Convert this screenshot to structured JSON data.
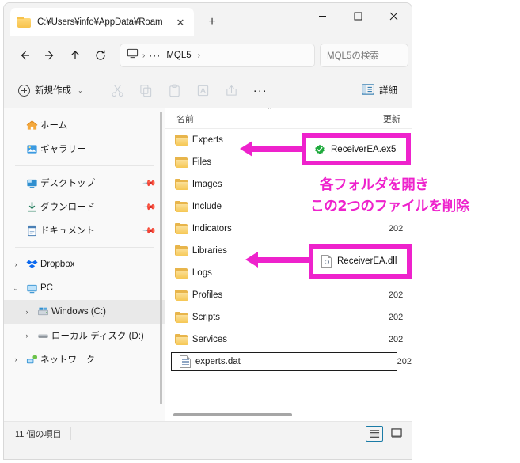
{
  "window": {
    "tab_title": "C:¥Users¥info¥AppData¥Roam",
    "tab_close_label": "✕",
    "new_tab_label": "+",
    "minimize_label": "Minimize",
    "maximize_label": "Maximize",
    "close_label": "Close"
  },
  "nav": {
    "back_label": "←",
    "forward_label": "→",
    "up_label": "↑",
    "refresh_label": "⟳",
    "breadcrumb": [
      {
        "type": "icon",
        "label": "this-pc"
      },
      {
        "type": "sep",
        "label": "›"
      },
      {
        "type": "ellipsis",
        "label": "···"
      },
      {
        "type": "crumb",
        "label": "MQL5"
      },
      {
        "type": "sep",
        "label": "›"
      }
    ],
    "search_placeholder": "MQL5の検索"
  },
  "toolbar": {
    "new_label": "新規作成",
    "new_chevron": "⌄",
    "cut_label": "Cut",
    "copy_label": "Copy",
    "paste_label": "Paste",
    "rename_label": "Rename",
    "share_label": "Share",
    "more_label": "···",
    "details_label": "詳細"
  },
  "sidebar": {
    "groups": [
      {
        "items": [
          {
            "label": "ホーム",
            "icon": "home-icon",
            "caret": "",
            "pin": false,
            "selected": false,
            "indent": 0
          },
          {
            "label": "ギャラリー",
            "icon": "gallery-icon",
            "caret": "",
            "pin": false,
            "selected": false,
            "indent": 0
          }
        ]
      },
      {
        "items": [
          {
            "label": "デスクトップ",
            "icon": "desktop-icon",
            "caret": "",
            "pin": true,
            "selected": false,
            "indent": 0
          },
          {
            "label": "ダウンロード",
            "icon": "download-icon",
            "caret": "",
            "pin": true,
            "selected": false,
            "indent": 0
          },
          {
            "label": "ドキュメント",
            "icon": "document-icon",
            "caret": "",
            "pin": true,
            "selected": false,
            "indent": 0
          }
        ]
      },
      {
        "items": [
          {
            "label": "Dropbox",
            "icon": "dropbox-icon",
            "caret": "›",
            "pin": false,
            "selected": false,
            "indent": 0
          },
          {
            "label": "PC",
            "icon": "pc-icon",
            "caret": "⌄",
            "pin": false,
            "selected": false,
            "indent": 0
          },
          {
            "label": "Windows (C:)",
            "icon": "drive-windows-icon",
            "caret": "›",
            "pin": false,
            "selected": true,
            "indent": 1
          },
          {
            "label": "ローカル ディスク (D:)",
            "icon": "drive-icon",
            "caret": "›",
            "pin": false,
            "selected": false,
            "indent": 1
          },
          {
            "label": "ネットワーク",
            "icon": "network-icon",
            "caret": "›",
            "pin": false,
            "selected": false,
            "indent": 0
          }
        ]
      }
    ]
  },
  "filelist": {
    "columns": {
      "name": "名前",
      "modified": "更新",
      "sort_indicator": "⌃"
    },
    "rows": [
      {
        "name": "Experts",
        "type": "folder",
        "modified": ""
      },
      {
        "name": "Files",
        "type": "folder",
        "modified": "202"
      },
      {
        "name": "Images",
        "type": "folder",
        "modified": ""
      },
      {
        "name": "Include",
        "type": "folder",
        "modified": ""
      },
      {
        "name": "Indicators",
        "type": "folder",
        "modified": "202"
      },
      {
        "name": "Libraries",
        "type": "folder",
        "modified": ""
      },
      {
        "name": "Logs",
        "type": "folder",
        "modified": "202"
      },
      {
        "name": "Profiles",
        "type": "folder",
        "modified": "202"
      },
      {
        "name": "Scripts",
        "type": "folder",
        "modified": "202"
      },
      {
        "name": "Services",
        "type": "folder",
        "modified": "202"
      },
      {
        "name": "experts.dat",
        "type": "dat",
        "modified": "202",
        "focused": true
      }
    ]
  },
  "status": {
    "item_count_label": "11 個の項目",
    "view_details_label": "Details view",
    "view_large_icons_label": "Large icons view"
  },
  "annotations": {
    "accent_color": "#ee22cc",
    "callout_ex5": "ReceiverEA.ex5",
    "callout_dll": "ReceiverEA.dll",
    "note_line1": "各フォルダを開き",
    "note_line2": "この2つのファイルを削除"
  }
}
